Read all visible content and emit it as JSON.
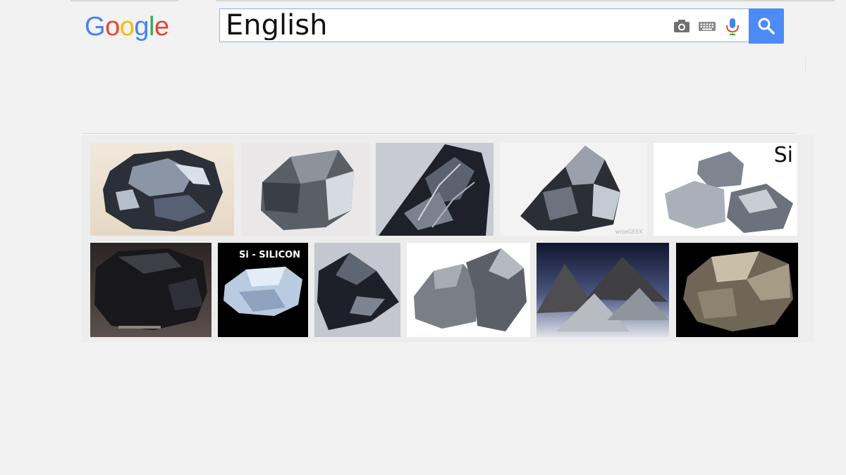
{
  "logo": {
    "letters": [
      "G",
      "o",
      "o",
      "g",
      "l",
      "e"
    ]
  },
  "search": {
    "query": "English"
  },
  "icons": {
    "camera": "camera-icon",
    "keyboard": "keyboard-icon",
    "mic": "mic-icon",
    "search": "search-icon"
  },
  "colors": {
    "accent": "#4c8bf5",
    "background": "#f2f2f2"
  },
  "results": {
    "row1": [
      {
        "caption": ""
      },
      {
        "caption": ""
      },
      {
        "caption": ""
      },
      {
        "caption": "",
        "watermark": "wiseGEEK"
      },
      {
        "caption": "",
        "corner_label": "Si"
      }
    ],
    "row2": [
      {
        "caption": ""
      },
      {
        "caption": "Si - SILICON"
      },
      {
        "caption": ""
      },
      {
        "caption": ""
      },
      {
        "caption": ""
      },
      {
        "caption": ""
      }
    ]
  }
}
